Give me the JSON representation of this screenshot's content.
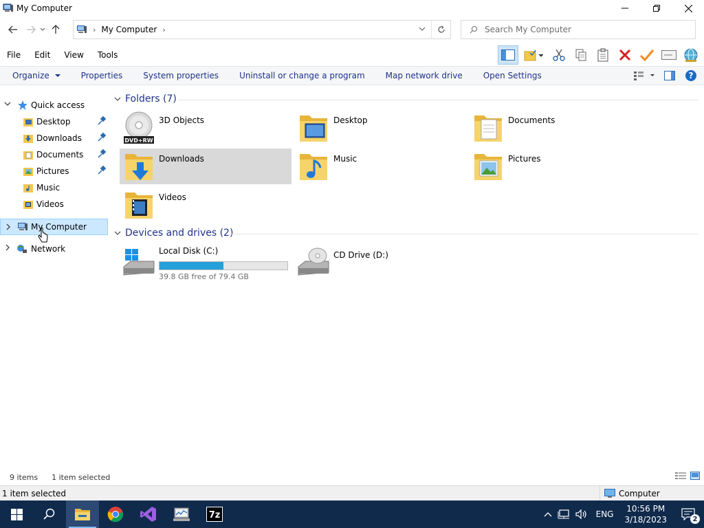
{
  "window": {
    "title": "My Computer"
  },
  "address": {
    "crumb": "My Computer",
    "search_placeholder": "Search My Computer"
  },
  "menu": [
    "File",
    "Edit",
    "View",
    "Tools"
  ],
  "commands": [
    "Organize",
    "Properties",
    "System properties",
    "Uninstall or change a program",
    "Map network drive",
    "Open Settings"
  ],
  "nav": {
    "quick_access": "Quick access",
    "quick_items": [
      {
        "label": "Desktop",
        "pinned": true
      },
      {
        "label": "Downloads",
        "pinned": true
      },
      {
        "label": "Documents",
        "pinned": true
      },
      {
        "label": "Pictures",
        "pinned": true
      },
      {
        "label": "Music",
        "pinned": false
      },
      {
        "label": "Videos",
        "pinned": false
      }
    ],
    "my_computer": "My Computer",
    "network": "Network"
  },
  "folders": {
    "header": "Folders (7)",
    "items": [
      "3D Objects",
      "Desktop",
      "Documents",
      "Downloads",
      "Music",
      "Pictures",
      "Videos"
    ],
    "selected": "Downloads"
  },
  "drives": {
    "header": "Devices and drives (2)",
    "items": [
      {
        "label": "Local Disk (C:)",
        "free_text": "39.8 GB free of 79.4 GB",
        "used_fraction": 0.5
      },
      {
        "label": "CD Drive (D:)"
      }
    ]
  },
  "status": {
    "items": "9 items",
    "selected": "1 item selected"
  },
  "status2": {
    "selected": "1 item selected",
    "zone": "Computer"
  },
  "taskbar": {
    "time": "10:56 PM",
    "date": "3/18/2023",
    "lang": "ENG",
    "notifications": "2"
  },
  "colors": {
    "accent": "#26a0da",
    "taskbar": "#102a4c",
    "selection": "#cce8ff"
  }
}
